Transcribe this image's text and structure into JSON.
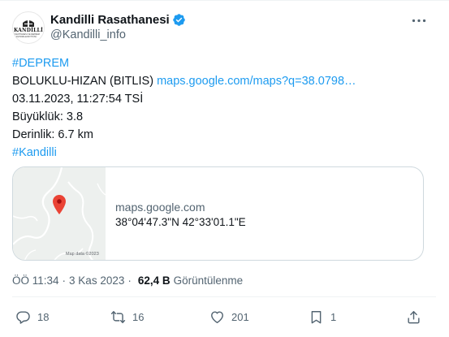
{
  "author": {
    "display_name": "Kandilli Rasathanesi",
    "handle": "@Kandilli_info",
    "avatar_text": "KANDİLLİ",
    "avatar_subtext": "RASATHANESI VE DEPREM ARAŞTIRMA ENSTİTÜSÜ"
  },
  "tweet": {
    "hashtag_top": "#DEPREM",
    "location": "BOLUKLU-HIZAN (BITLIS)",
    "map_link": "maps.google.com/maps?q=38.0798…",
    "datetime": "03.11.2023, 11:27:54 TSİ",
    "magnitude": "Büyüklük: 3.8",
    "depth": "Derinlik: 6.7 km",
    "hashtag_bottom": "#Kandilli"
  },
  "card": {
    "domain": "maps.google.com",
    "coords": "38°04'47.3\"N 42°33'01.1\"E",
    "map_credit": "Map data ©2023"
  },
  "meta": {
    "time": "ÖÖ 11:34",
    "separator": "·",
    "date": "3 Kas 2023",
    "views_count": "62,4 B",
    "views_label": "Görüntülenme"
  },
  "actions": {
    "reply_count": "18",
    "retweet_count": "16",
    "like_count": "201",
    "bookmark_count": "1"
  },
  "colors": {
    "accent": "#1d9bf0",
    "text_primary": "#0f1419",
    "text_secondary": "#536471",
    "pin": "#ea4335"
  }
}
